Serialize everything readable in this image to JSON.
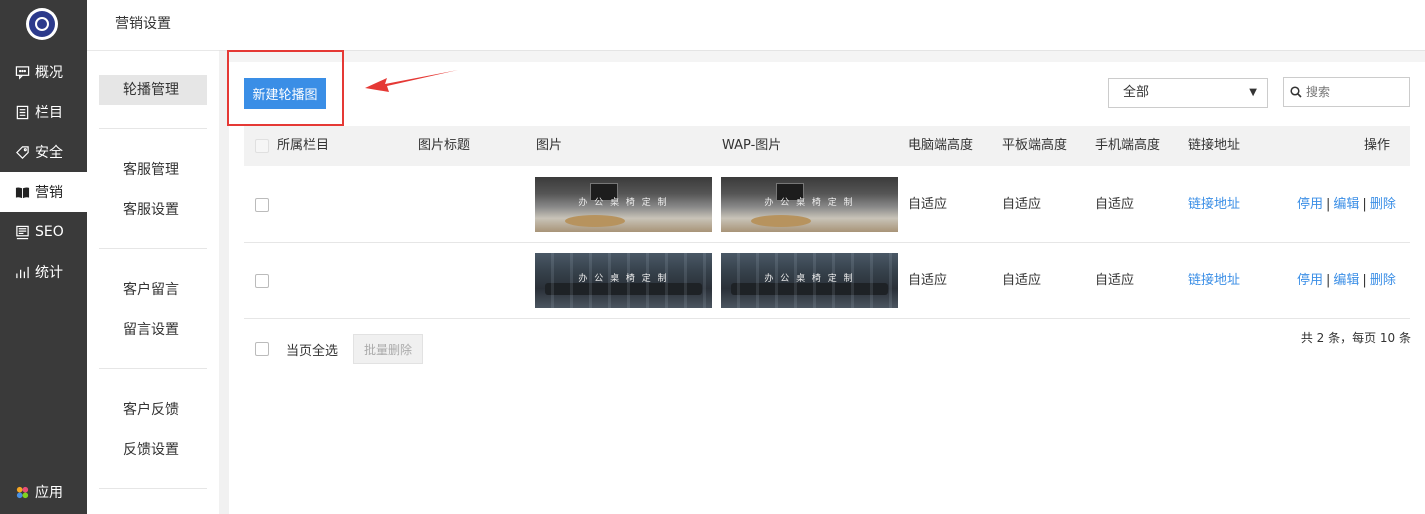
{
  "nav": {
    "items": [
      {
        "label": "概况",
        "icon": "chat-icon"
      },
      {
        "label": "栏目",
        "icon": "document-icon"
      },
      {
        "label": "安全",
        "icon": "tag-icon"
      },
      {
        "label": "营销",
        "icon": "book-icon",
        "active": true
      },
      {
        "label": "SEO",
        "icon": "seo-icon"
      },
      {
        "label": "统计",
        "icon": "bar-chart-icon"
      }
    ],
    "apps_label": "应用"
  },
  "side": {
    "title": "营销设置",
    "items": [
      "轮播管理",
      "客服管理",
      "客服设置",
      "客户留言",
      "留言设置",
      "客户反馈",
      "反馈设置"
    ]
  },
  "toolbar": {
    "new_button": "新建轮播图",
    "filter_value": "全部",
    "search_placeholder": "搜索"
  },
  "table": {
    "headers": [
      "所属栏目",
      "图片标题",
      "图片",
      "WAP-图片",
      "电脑端高度",
      "平板端高度",
      "手机端高度",
      "链接地址",
      "操作"
    ],
    "rows": [
      {
        "category": "",
        "title": "",
        "image_caption": "办 公 桌 椅 定 制",
        "pc_height": "自适应",
        "tablet_height": "自适应",
        "mobile_height": "自适应",
        "link": "链接地址"
      },
      {
        "category": "",
        "title": "",
        "image_caption": "办 公 桌 椅 定 制",
        "pc_height": "自适应",
        "tablet_height": "自适应",
        "mobile_height": "自适应",
        "link": "链接地址"
      }
    ],
    "actions": {
      "disable": "停用",
      "edit": "编辑",
      "delete": "删除",
      "sep": "|"
    }
  },
  "footer": {
    "select_all": "当页全选",
    "batch_delete": "批量删除",
    "pager": "共 2 条，每页 10 条"
  },
  "colors": {
    "nav_bg": "#3a3a3a",
    "accent": "#3a8ee6",
    "highlight_border": "#e53935"
  }
}
